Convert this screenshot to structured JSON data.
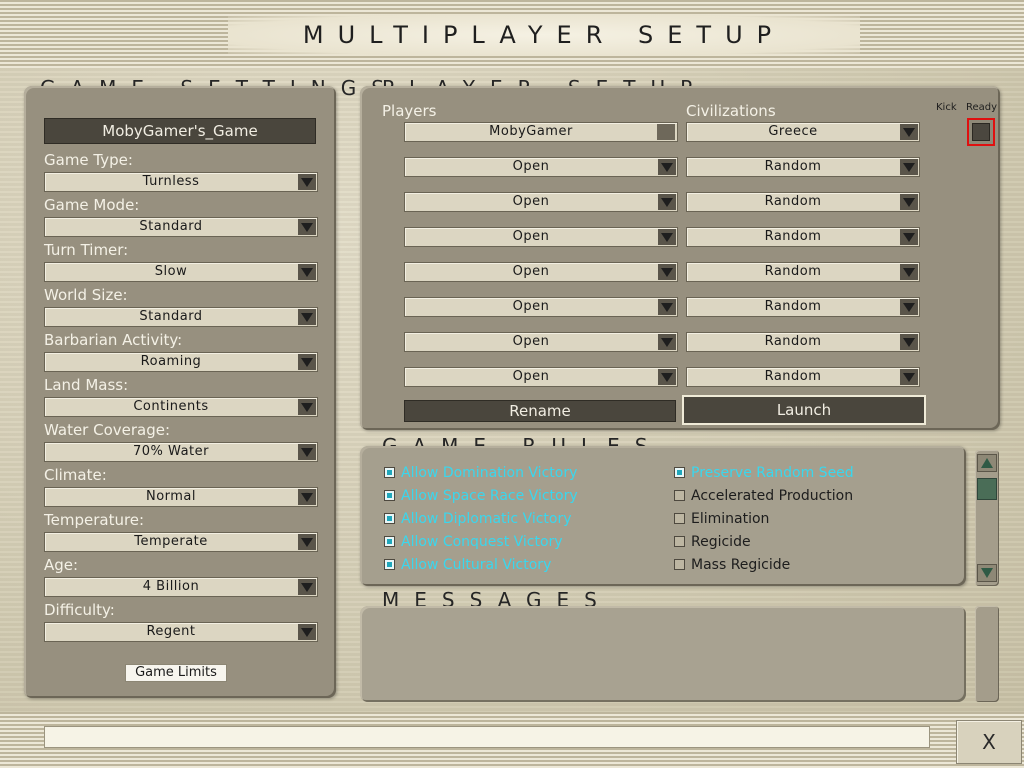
{
  "window": {
    "title": "MULTIPLAYER SETUP"
  },
  "game_settings": {
    "header": "GAME SETTINGS",
    "game_name": "MobyGamer's_Game",
    "fields": [
      {
        "label": "Game Type:",
        "value": "Turnless"
      },
      {
        "label": "Game Mode:",
        "value": "Standard"
      },
      {
        "label": "Turn Timer:",
        "value": "Slow"
      },
      {
        "label": "World Size:",
        "value": "Standard"
      },
      {
        "label": "Barbarian Activity:",
        "value": "Roaming"
      },
      {
        "label": "Land Mass:",
        "value": "Continents"
      },
      {
        "label": "Water Coverage:",
        "value": "70% Water"
      },
      {
        "label": "Climate:",
        "value": "Normal"
      },
      {
        "label": "Temperature:",
        "value": "Temperate"
      },
      {
        "label": "Age:",
        "value": "4 Billion"
      },
      {
        "label": "Difficulty:",
        "value": "Regent"
      }
    ],
    "limits_button": "Game Limits"
  },
  "player_setup": {
    "header": "PLAYER SETUP",
    "players_header": "Players",
    "civs_header": "Civilizations",
    "kick_header": "Kick",
    "ready_header": "Ready",
    "rows": [
      {
        "player": "MobyGamer",
        "civ": "Greece"
      },
      {
        "player": "Open",
        "civ": "Random"
      },
      {
        "player": "Open",
        "civ": "Random"
      },
      {
        "player": "Open",
        "civ": "Random"
      },
      {
        "player": "Open",
        "civ": "Random"
      },
      {
        "player": "Open",
        "civ": "Random"
      },
      {
        "player": "Open",
        "civ": "Random"
      },
      {
        "player": "Open",
        "civ": "Random"
      }
    ],
    "rename_button": "Rename",
    "launch_button": "Launch"
  },
  "game_rules": {
    "header": "GAME RULES",
    "left": [
      {
        "label": "Allow Domination Victory",
        "checked": true
      },
      {
        "label": "Allow Space Race Victory",
        "checked": true
      },
      {
        "label": "Allow Diplomatic Victory",
        "checked": true
      },
      {
        "label": "Allow Conquest Victory",
        "checked": true
      },
      {
        "label": "Allow Cultural Victory",
        "checked": true
      }
    ],
    "right": [
      {
        "label": "Preserve Random Seed",
        "checked": true
      },
      {
        "label": "Accelerated Production",
        "checked": false
      },
      {
        "label": "Elimination",
        "checked": false
      },
      {
        "label": "Regicide",
        "checked": false
      },
      {
        "label": "Mass Regicide",
        "checked": false
      }
    ]
  },
  "messages": {
    "header": "MESSAGES"
  },
  "footer": {
    "close_glyph": "X"
  },
  "colors": {
    "rule_on": "#39d7ee",
    "ready_border": "#e01010",
    "panel": "#97907f"
  },
  "icons": [
    "chevron-down-icon",
    "close-icon",
    "scroll-up-icon",
    "scroll-down-icon"
  ]
}
